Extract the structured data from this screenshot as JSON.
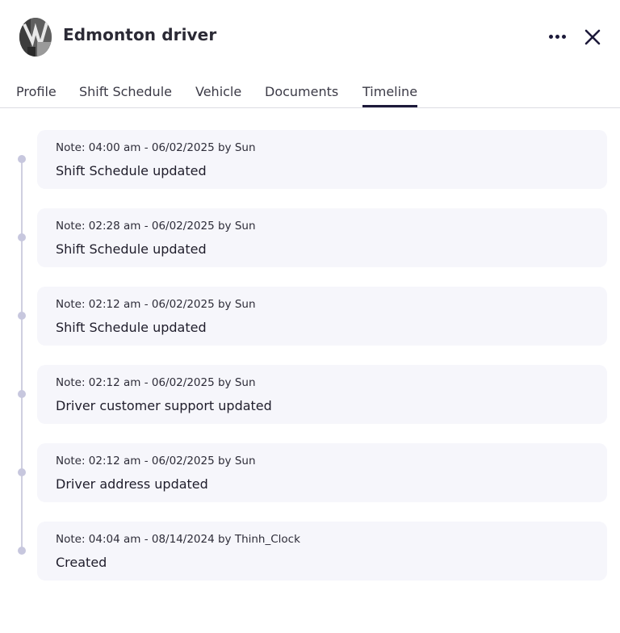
{
  "header": {
    "title": "Edmonton driver",
    "avatar_icon": "driver-photo",
    "more_icon": "more-horizontal-icon",
    "close_icon": "close-icon"
  },
  "tabs": [
    {
      "label": "Profile"
    },
    {
      "label": "Shift Schedule"
    },
    {
      "label": "Vehicle"
    },
    {
      "label": "Documents"
    },
    {
      "label": "Timeline",
      "active": true
    }
  ],
  "timeline": [
    {
      "meta": "Note: 04:00 am - 06/02/2025 by Sun",
      "message": "Shift Schedule updated"
    },
    {
      "meta": "Note: 02:28 am - 06/02/2025 by Sun",
      "message": "Shift Schedule updated"
    },
    {
      "meta": "Note: 02:12 am - 06/02/2025 by Sun",
      "message": "Shift Schedule updated"
    },
    {
      "meta": "Note: 02:12 am - 06/02/2025 by Sun",
      "message": "Driver customer support updated"
    },
    {
      "meta": "Note: 02:12 am - 06/02/2025 by Sun",
      "message": "Driver address updated"
    },
    {
      "meta": "Note: 04:04 am - 08/14/2024 by Thinh_Clock",
      "message": "Created"
    }
  ],
  "colors": {
    "accent": "#1d1a3a",
    "card_bg": "#f6f6fb",
    "timeline_dot": "#c7c7de"
  }
}
